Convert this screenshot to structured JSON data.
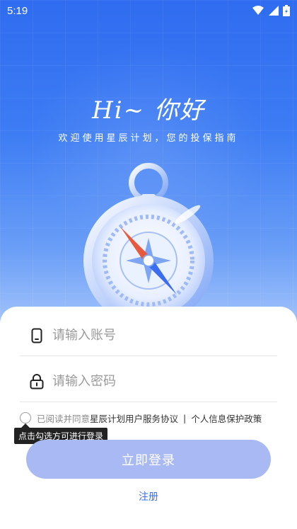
{
  "status_bar": {
    "time": "5:19",
    "icons": [
      "wifi-icon",
      "signal-icon",
      "battery-icon"
    ]
  },
  "hero": {
    "headline": "Hi~ 你好",
    "subline": "欢迎使用星辰计划，您的投保指南",
    "illustration": "compass-icon"
  },
  "form": {
    "account_placeholder": "请输入账号",
    "password_placeholder": "请输入密码",
    "account_icon": "phone-icon",
    "password_icon": "lock-icon"
  },
  "agreement": {
    "prefix": "已阅读并同意",
    "service_link": "星辰计划用户服务协议",
    "separator": "|",
    "privacy_link": "个人信息保护政策",
    "checked": false
  },
  "tooltip": {
    "text": "点击勾选方可进行登录"
  },
  "actions": {
    "login_label": "立即登录",
    "register_label": "注册"
  },
  "colors": {
    "primary": "#3a6df0",
    "login_disabled": "#a9b9f4",
    "hero_top": "#2f6cf0"
  }
}
